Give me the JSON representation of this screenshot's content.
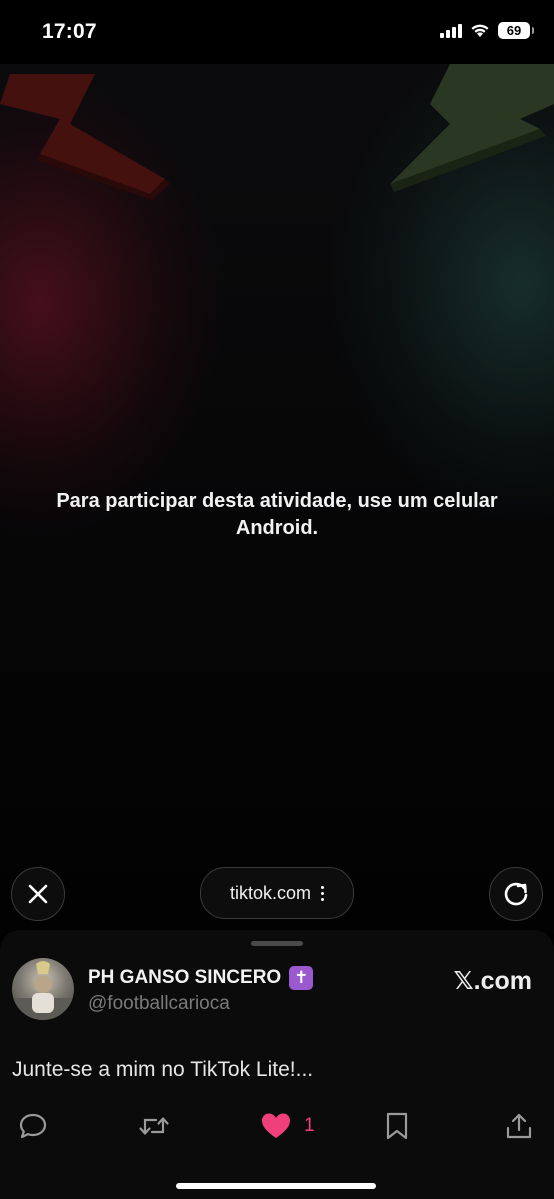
{
  "status": {
    "time": "17:07",
    "battery": "69"
  },
  "webview": {
    "message": "Para participar desta atividade, use um celular Android."
  },
  "browser_bar": {
    "url": "tiktok.com"
  },
  "tweet": {
    "display_name": "PH GANSO SINCERO",
    "badge": "✝️",
    "handle": "@footballcarioca",
    "site": "𝕏.com",
    "text": "Junte-se a mim no TikTok Lite!...",
    "like_count": "1"
  },
  "colors": {
    "like": "#f0407c",
    "badge": "#9b59d0"
  },
  "icons": [
    "signal-icon",
    "wifi-icon",
    "battery-icon",
    "close-icon",
    "more-vertical-icon",
    "reload-icon",
    "reply-icon",
    "retweet-icon",
    "heart-icon",
    "bookmark-icon",
    "share-icon"
  ]
}
